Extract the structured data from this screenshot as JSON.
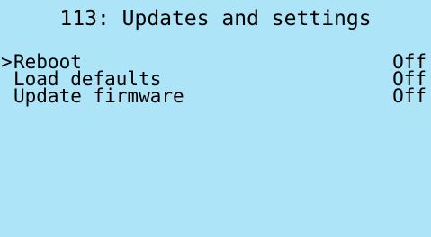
{
  "screen": {
    "title": "113: Updates and settings",
    "background": "#ade4f8",
    "text_color": "#000000",
    "cursor_symbol": ">",
    "items": [
      {
        "label": "Reboot",
        "value": "Off",
        "selected": true
      },
      {
        "label": "Load defaults",
        "value": "Off",
        "selected": false
      },
      {
        "label": "Update firmware",
        "value": "Off",
        "selected": false
      }
    ]
  }
}
